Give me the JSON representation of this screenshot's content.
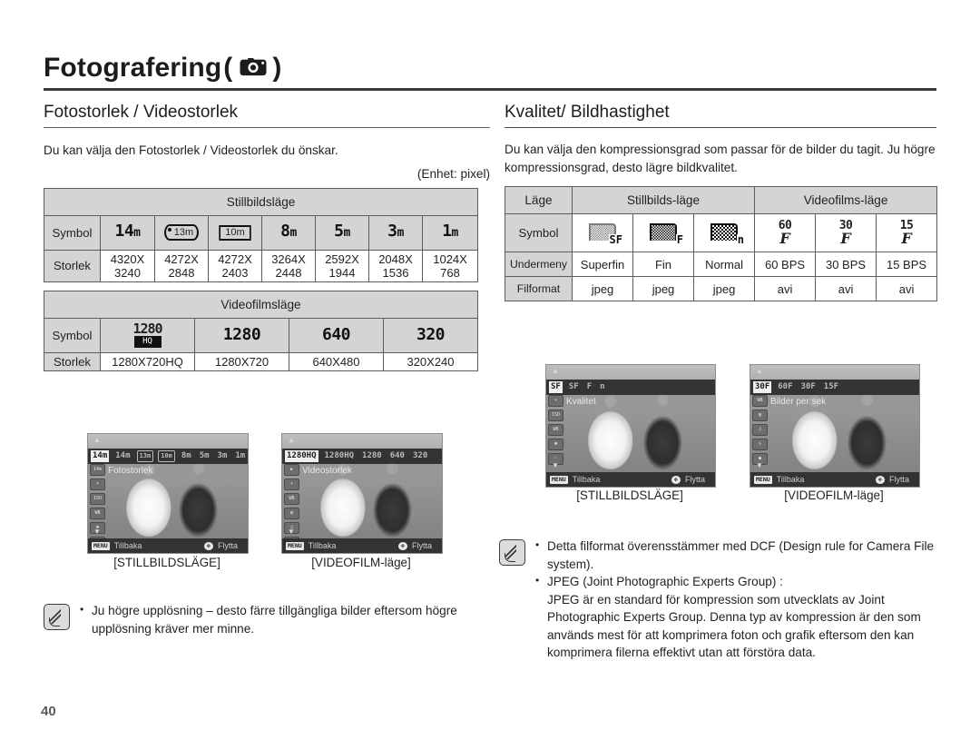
{
  "header": {
    "chapter_title": "Fotografering",
    "paren_open": "(",
    "paren_close": ")",
    "camera_icon": "camera-icon"
  },
  "left_column": {
    "section_title": "Fotostorlek / Videostorlek",
    "intro": "Du kan välja den Fotostorlek / Videostorlek du önskar.",
    "unit_note": "(Enhet: pixel)",
    "still_table": {
      "header": "Stillbildsläge",
      "row_labels": [
        "Symbol",
        "Storlek"
      ],
      "symbols": [
        {
          "kind": "plain",
          "value": "14",
          "unit": "m"
        },
        {
          "kind": "boxed",
          "value": "13m"
        },
        {
          "kind": "pano",
          "value": "10m"
        },
        {
          "kind": "plain",
          "value": "8",
          "unit": "m"
        },
        {
          "kind": "plain",
          "value": "5",
          "unit": "m"
        },
        {
          "kind": "plain",
          "value": "3",
          "unit": "m"
        },
        {
          "kind": "plain",
          "value": "1",
          "unit": "m"
        }
      ],
      "sizes": [
        {
          "w": "4320X",
          "h": "3240"
        },
        {
          "w": "4272X",
          "h": "2848"
        },
        {
          "w": "4272X",
          "h": "2403"
        },
        {
          "w": "3264X",
          "h": "2448"
        },
        {
          "w": "2592X",
          "h": "1944"
        },
        {
          "w": "2048X",
          "h": "1536"
        },
        {
          "w": "1024X",
          "h": "768"
        }
      ]
    },
    "video_table": {
      "header": "Videofilmsläge",
      "row_labels": [
        "Symbol",
        "Storlek"
      ],
      "symbols": [
        {
          "kind": "hq",
          "value": "1280",
          "badge": "HQ"
        },
        {
          "kind": "plain",
          "value": "1280"
        },
        {
          "kind": "plain",
          "value": "640"
        },
        {
          "kind": "plain",
          "value": "320"
        }
      ],
      "sizes": [
        "1280X720HQ",
        "1280X720",
        "640X480",
        "320X240"
      ]
    },
    "screens": [
      {
        "menu_label": "Fotostorlek",
        "top_items": [
          "14m",
          "14m",
          "13m",
          "10m",
          "8m",
          "5m",
          "3m",
          "1m"
        ],
        "selected_index": 1,
        "back_key": "MENU",
        "back_label": "Tillbaka",
        "move_key": "✥",
        "move_label": "Flytta",
        "caption": "[STILLBILDSLÄGE]"
      },
      {
        "menu_label": "Videostorlek",
        "top_items": [
          "1280HQ",
          "1280HQ",
          "1280",
          "640",
          "320"
        ],
        "selected_index": 1,
        "back_key": "MENU",
        "back_label": "Tillbaka",
        "move_key": "✥",
        "move_label": "Flytta",
        "caption": "[VIDEOFILM-läge]"
      }
    ],
    "note": {
      "bullets": [
        "Ju högre upplösning – desto färre tillgängliga bilder eftersom högre upplösning kräver mer minne."
      ]
    }
  },
  "right_column": {
    "section_title": "Kvalitet/ Bildhastighet",
    "intro": "Du kan välja den kompressionsgrad som passar för de bilder du tagit. Ju högre kompressionsgrad, desto lägre bildkvalitet.",
    "quality_table": {
      "row_labels": [
        "Läge",
        "Symbol",
        "Undermeny",
        "Filformat"
      ],
      "group_headers": [
        "Stillbilds-läge",
        "Videofilms-läge"
      ],
      "symbols": [
        {
          "kind": "quality",
          "density": "fine",
          "tag": "SF"
        },
        {
          "kind": "quality",
          "density": "dense",
          "tag": "F"
        },
        {
          "kind": "quality",
          "density": "coarse",
          "tag": "n"
        },
        {
          "kind": "fps",
          "value": "60"
        },
        {
          "kind": "fps",
          "value": "30"
        },
        {
          "kind": "fps",
          "value": "15"
        }
      ],
      "submenu": [
        "Superfin",
        "Fin",
        "Normal",
        "60 BPS",
        "30 BPS",
        "15 BPS"
      ],
      "fileformat": [
        "jpeg",
        "jpeg",
        "jpeg",
        "avi",
        "avi",
        "avi"
      ]
    },
    "screens": [
      {
        "menu_label": "Kvalitet",
        "top_items": [
          "SF",
          "SF",
          "F",
          "n"
        ],
        "selected_index": 0,
        "back_key": "MENU",
        "back_label": "Tillbaka",
        "move_key": "✥",
        "move_label": "Flytta",
        "caption": "[STILLBILDSLÄGE]"
      },
      {
        "menu_label": "Bilder per sek",
        "top_items": [
          "30F",
          "60F",
          "30F",
          "15F"
        ],
        "selected_index": 0,
        "back_key": "MENU",
        "back_label": "Tillbaka",
        "move_key": "✥",
        "move_label": "Flytta",
        "caption": "[VIDEOFILM-läge]"
      }
    ],
    "note": {
      "bullets": [
        "Detta filformat överensstämmer med DCF (Design rule for Camera File system).",
        "JPEG (Joint Photographic Experts Group) :"
      ],
      "continuation": "JPEG är en standard för kompression som utvecklats av Joint Photographic Experts Group. Denna typ av kompression är den som används mest för att komprimera foton och grafik eftersom den kan komprimera filerna effektivt utan att förstöra data."
    }
  },
  "footer": {
    "page_number": "40"
  },
  "colors": {
    "table_header_bg": "#d4d4d4",
    "table_border": "#5d5d5d",
    "text": "#231f20",
    "rule": "#3a3a3a",
    "page_number": "#58595b"
  }
}
